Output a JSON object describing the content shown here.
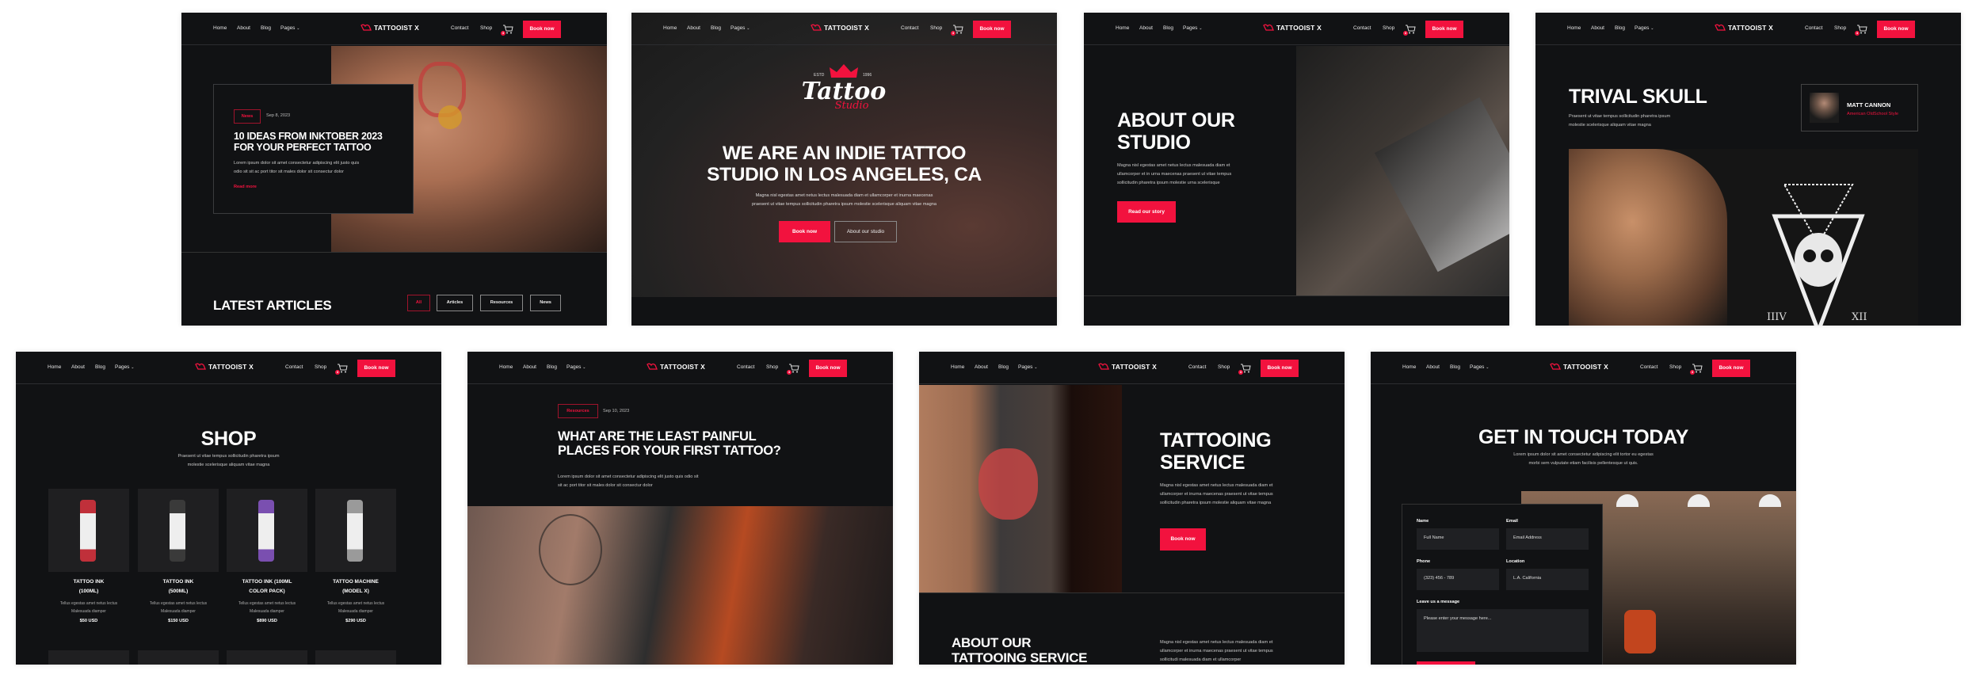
{
  "nav": {
    "links_left": [
      "Home",
      "About",
      "Blog",
      "Pages"
    ],
    "logo_text": "TATTOOIST X",
    "links_right": [
      "Contact",
      "Shop"
    ],
    "cart_count": "3",
    "book_label": "Book now"
  },
  "colors": {
    "accent": "#f2123e",
    "background": "#111214"
  },
  "blog_home": {
    "tag": "News",
    "date": "Sep 8, 2023",
    "title_line1": "10 IDEAS FROM INKTOBER 2023",
    "title_line2": "FOR YOUR PERFECT TATTOO",
    "excerpt_line1": "Lorem ipsum dolor sit amet consectetur adipiscing elit justo quis",
    "excerpt_line2": "odio sit sit ac port titor sit males dolor sit consectur dolor",
    "read_more": "Read more",
    "section_title": "LATEST ARTICLES",
    "filters": [
      "All",
      "Articles",
      "Resources",
      "News"
    ]
  },
  "home": {
    "logo_estd": "ESTD",
    "logo_year": "1996",
    "logo_word": "Tattoo",
    "logo_sub": "Studio",
    "title_line1": "WE ARE AN INDIE TATTOO",
    "title_line2": "STUDIO IN LOS ANGELES, CA",
    "text_line1": "Magna nisl egestas amet netus lectus malesuada diam et ullamcorper et inurna maecenas",
    "text_line2": "praesent ut vitae tempus sollicitudin pharetra ipsum molestie scelerisque aliquam vitae magna",
    "primary_btn": "Book now",
    "secondary_btn": "About our studio"
  },
  "about": {
    "title_line1": "ABOUT OUR",
    "title_line2": "STUDIO",
    "text_line1": "Magna nisl egestas amet netus lectus malesuada diam et",
    "text_line2": "ullamcorper et in urna maecenas praesent ut vitae tempus",
    "text_line3": "sollicitudin pharetra ipsum molestie urna scelerisque",
    "button": "Read our story"
  },
  "portfolio": {
    "title": "TRIVAL SKULL",
    "text_line1": "Praesent ut vitae tempus sollicitudin pharetra ipsum",
    "text_line2": "molestie scelerisque aliquam vitae magna",
    "artist_name": "MATT CANNON",
    "artist_style": "American OldSchool Style",
    "art_left_numeral": "IIIV",
    "art_right_numeral": "XII"
  },
  "shop": {
    "title": "SHOP",
    "text_line1": "Praesent ut vitae tempus sollicitudin pharetra ipsum",
    "text_line2": "molestie scelerisque aliquam vitae magna",
    "products": [
      {
        "name_line1": "TATTOO INK",
        "name_line2": "(100ML)",
        "desc_line1": "Tellus egestas amet netus lectus",
        "desc_line2": "Malesuada diamper",
        "price": "$50 USD"
      },
      {
        "name_line1": "TATTOO INK",
        "name_line2": "(500ML)",
        "desc_line1": "Tellus egestas amet netus lectus",
        "desc_line2": "Malesuada diamper",
        "price": "$150 USD"
      },
      {
        "name_line1": "TATTOO INK (100ML",
        "name_line2": "COLOR PACK)",
        "desc_line1": "Tellus egestas amet netus lectus",
        "desc_line2": "Malesuada diamper",
        "price": "$890 USD"
      },
      {
        "name_line1": "TATTOO MACHINE",
        "name_line2": "(MODEL X)",
        "desc_line1": "Tellus egestas amet netus lectus",
        "desc_line2": "Malesuada diamper",
        "price": "$290 USD"
      }
    ]
  },
  "post": {
    "tag": "Resources",
    "date": "Sep 10, 2023",
    "title_line1": "WHAT ARE THE LEAST PAINFUL",
    "title_line2": "PLACES FOR YOUR FIRST TATTOO?",
    "text_line1": "Lorem ipsum dolor sit amet consectetur adipiscing elit justo quis odio sit",
    "text_line2": "sit ac port titor sit males dolor sit consectur dolor"
  },
  "service": {
    "title_line1": "TATTOOING",
    "title_line2": "SERVICE",
    "text_line1": "Magna nisl egestas amet netus lectus malesuada diam et",
    "text_line2": "ullamcorper et inurna maecenas praesent ut vitae tempus",
    "text_line3": "sollicitudin pharetra ipsum molestie aliquam vitae magna",
    "button": "Book now",
    "section_title_line1": "ABOUT OUR",
    "section_title_line2": "TATTOOING SERVICE",
    "section_text_line1": "Magna nisl egestas amet netus lectus malesuada diam et",
    "section_text_line2": "ullamcorper et inurna maecenas praesent ut vitae tempus",
    "section_text_line3": "sollicitudi malesuada diam et ullamcorper"
  },
  "contact": {
    "title": "GET IN TOUCH TODAY",
    "text_line1": "Lorem ipsum dolor sit amet consectetur adipiscing elit tortor eu egestas",
    "text_line2": "morbi sem vulputate etiam facilisis pellentesque ut quis.",
    "name_label": "Name",
    "name_placeholder": "Full Name",
    "email_label": "Email",
    "email_placeholder": "Email Address",
    "phone_label": "Phone",
    "phone_value": "(323) 456 - 789",
    "location_label": "Location",
    "location_value": "L.A. California",
    "message_label": "Leave us a message",
    "message_placeholder": "Please enter your message here..."
  }
}
